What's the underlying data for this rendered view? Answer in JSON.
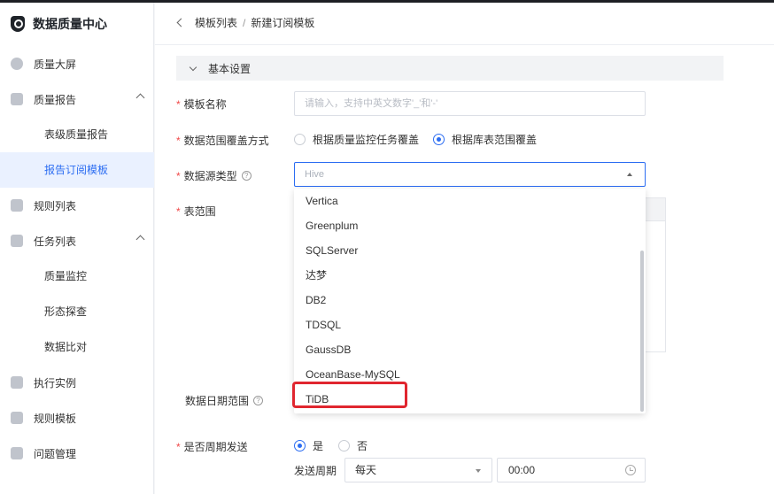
{
  "app": {
    "title": "数据质量中心"
  },
  "sidebar": {
    "items": [
      {
        "label": "质量大屏"
      },
      {
        "label": "质量报告"
      },
      {
        "label": "表级质量报告"
      },
      {
        "label": "报告订阅模板"
      },
      {
        "label": "规则列表"
      },
      {
        "label": "任务列表"
      },
      {
        "label": "质量监控"
      },
      {
        "label": "形态探查"
      },
      {
        "label": "数据比对"
      },
      {
        "label": "执行实例"
      },
      {
        "label": "规则模板"
      },
      {
        "label": "问题管理"
      }
    ]
  },
  "breadcrumb": {
    "parent": "模板列表",
    "separator": "/",
    "current": "新建订阅模板"
  },
  "section": {
    "title": "基本设置"
  },
  "form": {
    "name_label": "模板名称",
    "name_placeholder": "请输入，支持中英文数字'_'和'-'",
    "coverage_label": "数据范围覆盖方式",
    "coverage_options": [
      "根据质量监控任务覆盖",
      "根据库表范围覆盖"
    ],
    "coverage_selected": "根据库表范围覆盖",
    "source_label": "数据源类型",
    "source_value": "Hive",
    "table_scope_label": "表范围",
    "date_range_label": "数据日期范围",
    "periodic_label": "是否周期发送",
    "periodic_options": [
      "是",
      "否"
    ],
    "period_label": "发送周期",
    "period_value": "每天",
    "time_value": "00:00"
  },
  "dropdown": {
    "options": [
      "Vertica",
      "Greenplum",
      "SQLServer",
      "达梦",
      "DB2",
      "TDSQL",
      "GaussDB",
      "OceanBase-MySQL",
      "TiDB"
    ],
    "highlighted": "TiDB"
  },
  "colors": {
    "accent": "#2c6df2",
    "required": "#f04848",
    "highlight": "#e0262f"
  }
}
